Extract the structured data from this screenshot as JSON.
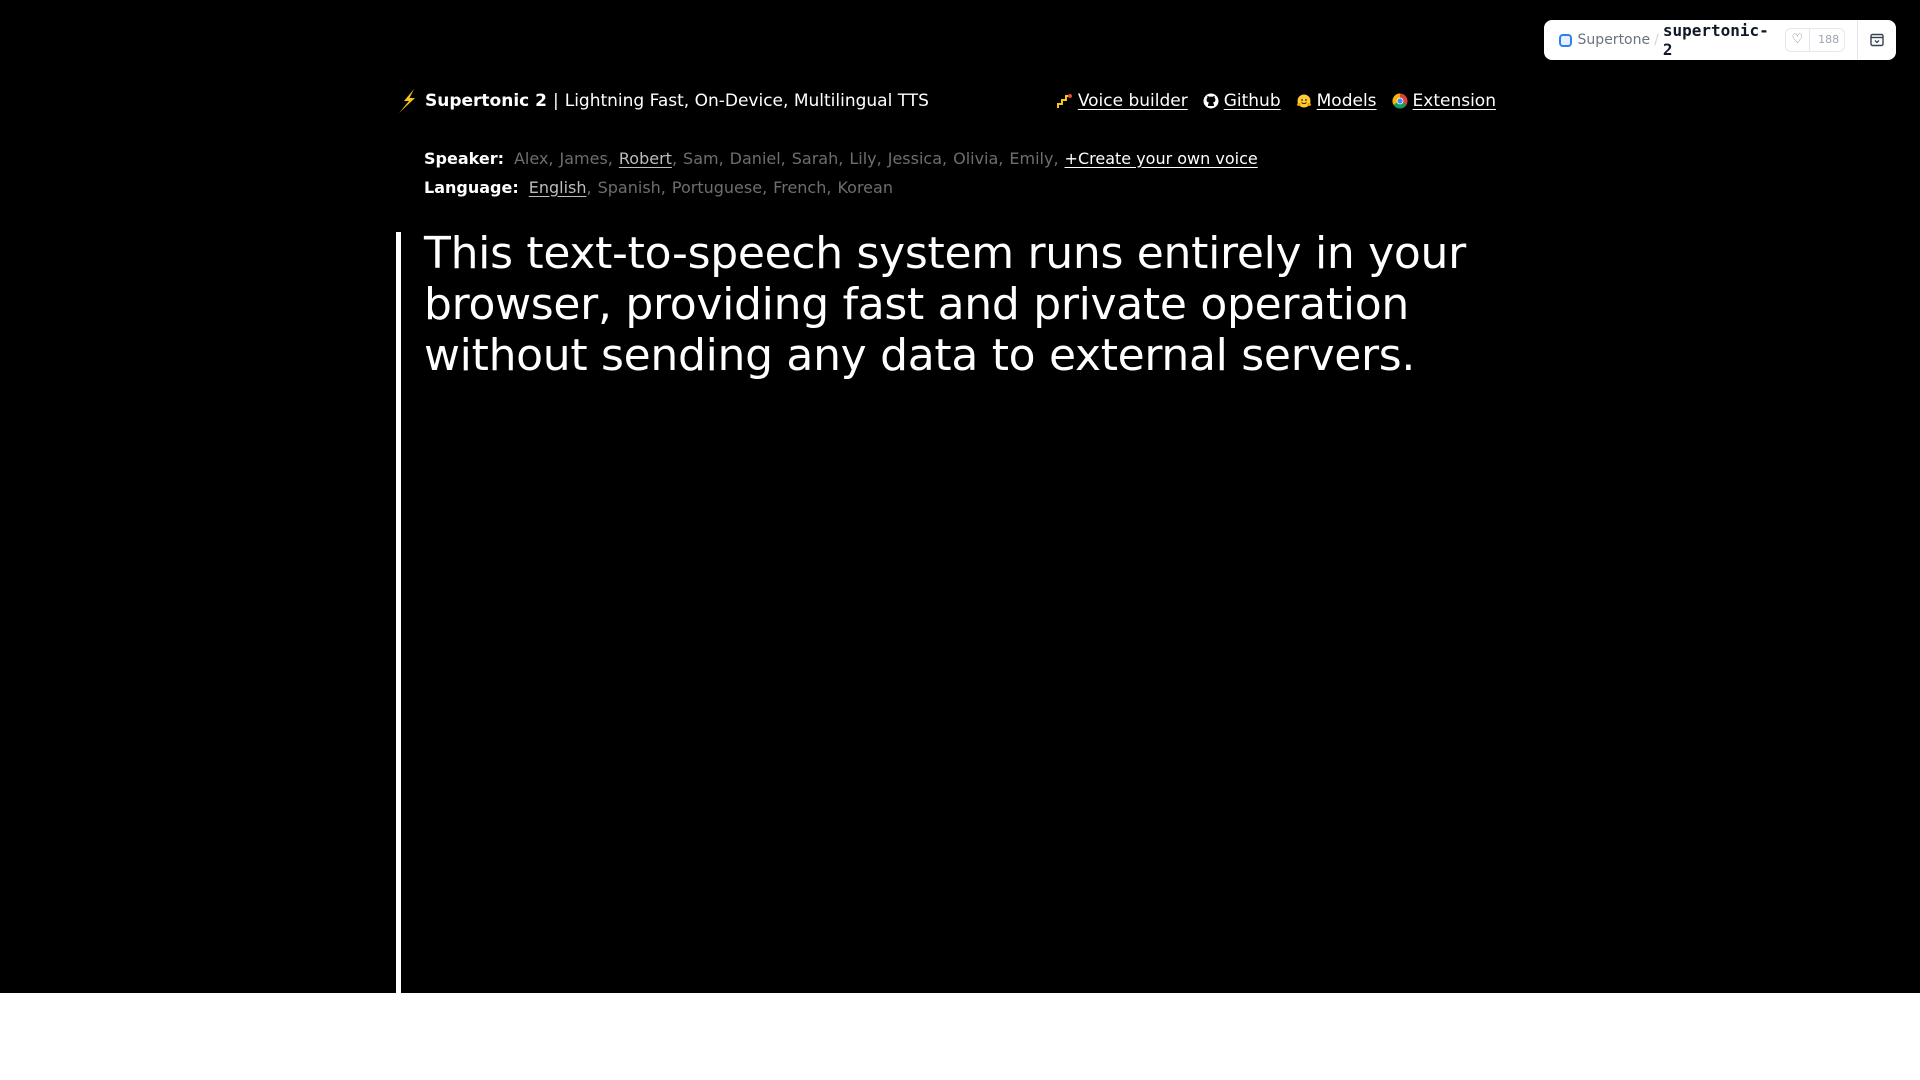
{
  "hf_badge": {
    "org": "Supertone",
    "repo": "supertonic-2",
    "likes": "188",
    "icons": {
      "org": "supertone-logo-icon",
      "like": "heart-icon",
      "menu": "window-icon"
    }
  },
  "header": {
    "brand_name": "Supertonic 2",
    "divider": "|",
    "tagline": "Lightning Fast, On-Device, Multilingual TTS",
    "nav": [
      {
        "label": "Voice builder",
        "icon": "stairs-icon"
      },
      {
        "label": "Github",
        "icon": "github-icon"
      },
      {
        "label": "Models",
        "icon": "hugging-face-icon"
      },
      {
        "label": "Extension",
        "icon": "chrome-icon"
      }
    ]
  },
  "speaker": {
    "label": "Speaker:",
    "options": [
      "Alex",
      "James",
      "Robert",
      "Sam",
      "Daniel",
      "Sarah",
      "Lily",
      "Jessica",
      "Olivia",
      "Emily"
    ],
    "selected": "Robert",
    "create_label": "+Create your own voice"
  },
  "language": {
    "label": "Language:",
    "options": [
      "English",
      "Spanish",
      "Portuguese",
      "French",
      "Korean"
    ],
    "selected": "English"
  },
  "editor": {
    "text": "This text-to-speech system runs entirely in your browser, providing fast and private operation without sending any data to external servers."
  },
  "colors": {
    "background": "#000000",
    "text": "#ffffff",
    "inactive_option": "#6e6e6e",
    "active_option": "#bdbdbd",
    "bolt": "#f5c518"
  }
}
